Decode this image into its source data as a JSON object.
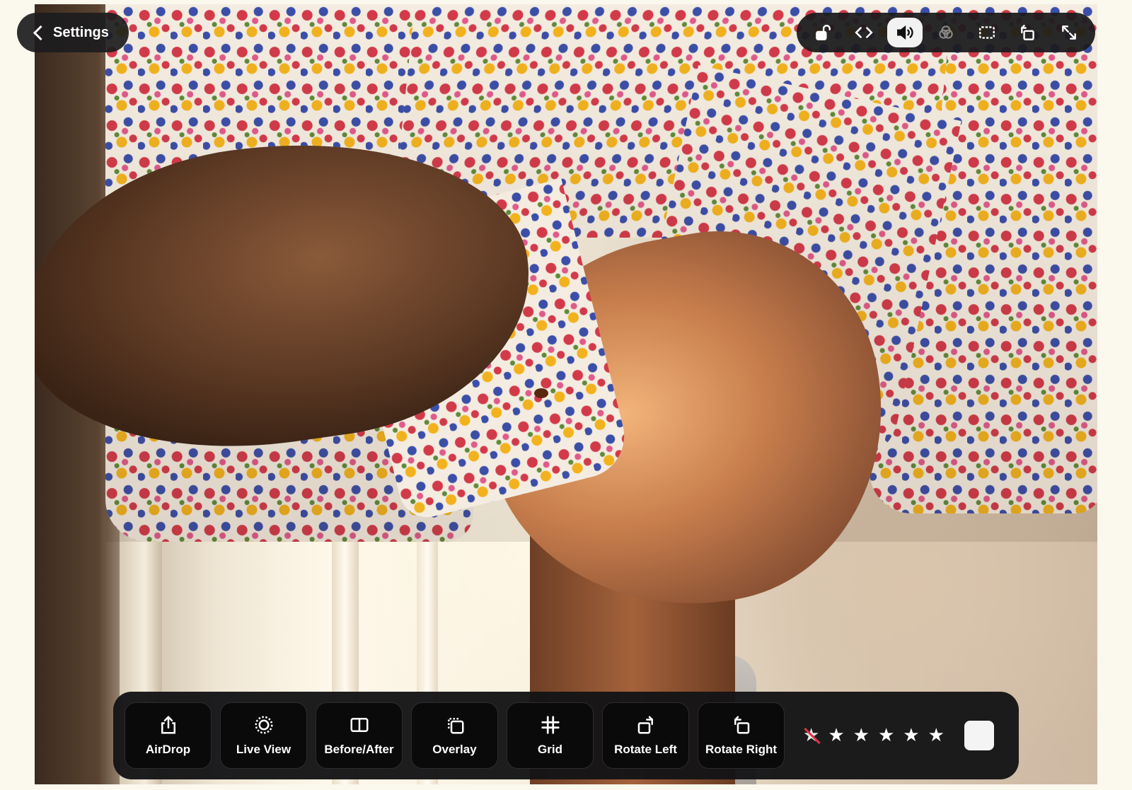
{
  "settings": {
    "label": "Settings"
  },
  "top_toolbar": {
    "buttons": [
      {
        "icon": "unlock-icon",
        "active": false
      },
      {
        "icon": "code-brackets-icon",
        "active": false
      },
      {
        "icon": "speaker-icon",
        "active": true
      },
      {
        "icon": "overlay-circles-icon",
        "active": false
      },
      {
        "icon": "crop-marquee-icon",
        "active": false
      },
      {
        "icon": "rotate-square-icon",
        "active": false
      },
      {
        "icon": "expand-arrows-icon",
        "active": false
      }
    ]
  },
  "bottom_toolbar": {
    "tools": [
      {
        "label": "AirDrop",
        "icon": "share-icon"
      },
      {
        "label": "Live View",
        "icon": "live-view-icon"
      },
      {
        "label": "Before/After",
        "icon": "split-view-icon"
      },
      {
        "label": "Overlay",
        "icon": "overlay-icon"
      },
      {
        "label": "Grid",
        "icon": "grid-icon"
      },
      {
        "label": "Rotate Left",
        "icon": "rotate-left-icon"
      },
      {
        "label": "Rotate Right",
        "icon": "rotate-right-icon"
      }
    ],
    "rating": {
      "max": 5,
      "value": 5
    },
    "color_label": "#f4f4f4"
  }
}
